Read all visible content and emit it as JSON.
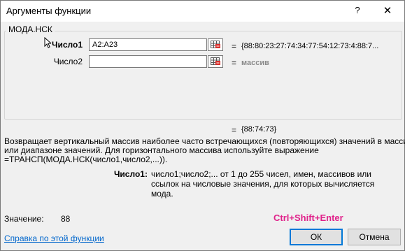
{
  "window": {
    "title": "Аргументы функции",
    "help_glyph": "?",
    "close_glyph": "✕"
  },
  "function": {
    "name": "МОДА.НСК",
    "args": [
      {
        "label": "Число1",
        "value": "A2:A23",
        "result": "{88:80:23:27:74:34:77:54:12:73:4:88:7...",
        "bold": true
      },
      {
        "label": "Число2",
        "value": "",
        "result": "массив",
        "bold": false
      }
    ],
    "equals": "=",
    "result": "{88:74:73}"
  },
  "description": {
    "lines": [
      "Возвращает вертикальный массив наиболее часто встречающихся (повторяющихся) значений в массиве",
      "или диапазоне значений. Для горизонтального массива используйте выражение",
      "=ТРАНСП(МОДА.НСК(число1,число2,...))."
    ],
    "arg_name": "Число1:",
    "arg_text": "число1;число2;... от 1 до 255 чисел, имен, массивов или ссылок на числовые значения, для которых вычисляется мода."
  },
  "footer": {
    "value_label": "Значение:",
    "value": "88",
    "hotkey": "Ctrl+Shift+Enter",
    "help_link": "Справка по этой функции",
    "ok_label": "ОК",
    "cancel_label": "Отмена"
  },
  "colors": {
    "hotkey": "#e0218a",
    "link": "#0066cc",
    "accent": "#0078d7"
  }
}
